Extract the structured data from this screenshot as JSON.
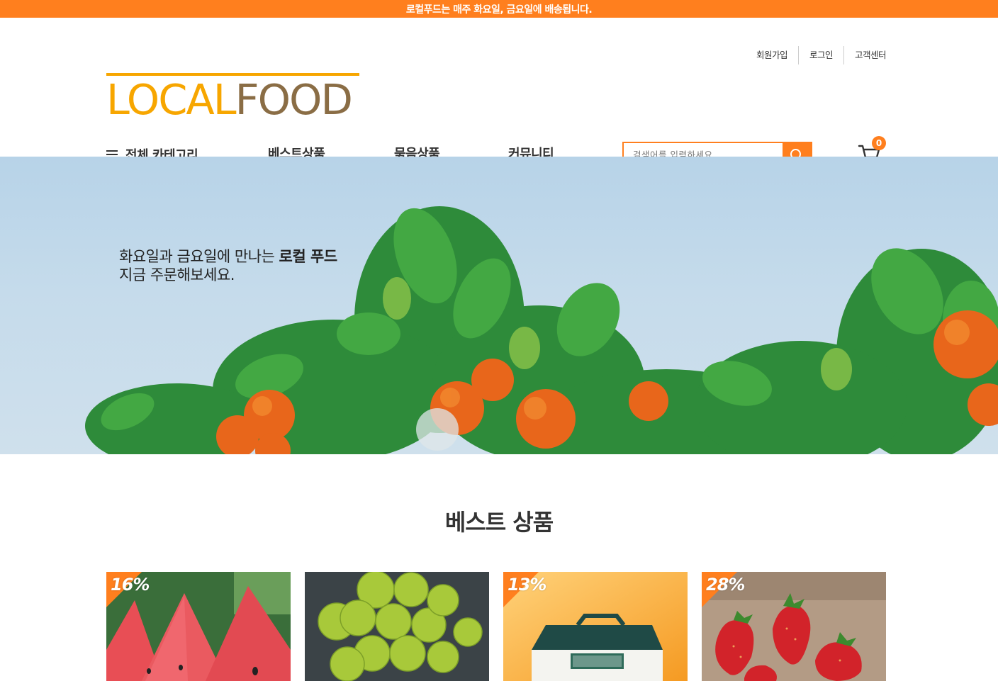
{
  "topbar": {
    "notice": "로컬푸드는 매주 화요일, 금요일에 배송됩니다."
  },
  "util_nav": [
    {
      "label": "회원가입"
    },
    {
      "label": "로그인"
    },
    {
      "label": "고객센터"
    }
  ],
  "logo": {
    "part1": "LOCAL",
    "part2": "FOOD"
  },
  "gnb": {
    "category_label": "전체 카테고리",
    "menu": [
      "베스트상품",
      "묶음상품",
      "커뮤니티"
    ]
  },
  "search": {
    "placeholder": "검색어를 입력하세요."
  },
  "cart": {
    "count": "0"
  },
  "hero": {
    "line1_prefix": "화요일과 금요일에 만나는 ",
    "line1_bold": "로컬 푸드",
    "line2": "지금 주문해보세요."
  },
  "best": {
    "title": "베스트 상품",
    "products": [
      {
        "discount": "16%",
        "image": "watermelon"
      },
      {
        "discount": "",
        "image": "green-grapes"
      },
      {
        "discount": "13%",
        "image": "gift-box"
      },
      {
        "discount": "28%",
        "image": "strawberries"
      }
    ]
  },
  "colors": {
    "accent": "#ff7f1e",
    "logo_local": "#f7a600",
    "logo_food": "#8a6d45"
  }
}
